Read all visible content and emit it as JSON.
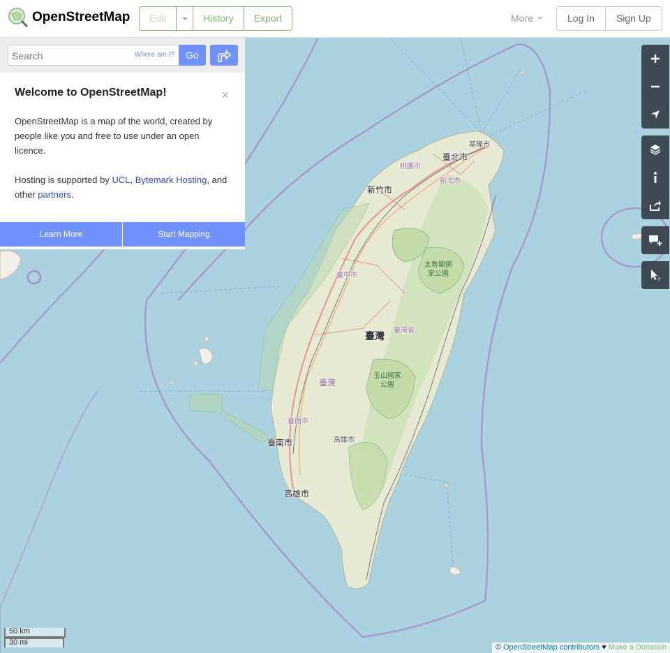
{
  "header": {
    "site_name": "OpenStreetMap",
    "edit_label": "Edit",
    "history_label": "History",
    "export_label": "Export",
    "more_label": "More",
    "login_label": "Log In",
    "signup_label": "Sign Up"
  },
  "search": {
    "placeholder": "Search",
    "where_am_i": "Where am I?",
    "go_label": "Go"
  },
  "welcome": {
    "title": "Welcome to OpenStreetMap!",
    "close": "×",
    "intro": "OpenStreetMap is a map of the world, created by people like you and free to use under an open licence.",
    "hosting_prefix": "Hosting is supported by ",
    "ucl": "UCL",
    "comma": ", ",
    "bytemark": "Bytemark Hosting",
    "and_other": ", and other ",
    "partners": "partners",
    "period": ".",
    "learn_more": "Learn More",
    "start_mapping": "Start Mapping"
  },
  "map": {
    "labels": {
      "keelung": "基隆市",
      "taipei": "臺北市",
      "taoyuan": "桃園市",
      "new_taipei": "新北市",
      "hsinchu": "新竹市",
      "taichung": "臺中市",
      "taiwan": "臺灣",
      "taiwan_province": "臺灣省",
      "taiwan_west": "臺灣",
      "tainan_minor": "臺南市",
      "tainan": "臺南市",
      "kaohsiung_minor": "高雄市",
      "kaohsiung": "高雄市",
      "taroko_1": "太魯閣國",
      "taroko_2": "家公園",
      "yushan_1": "玉山國家",
      "yushan_2": "公園"
    },
    "colors": {
      "water": "#aad3df",
      "land": "#f2efe9",
      "forest": "#d8e8c8",
      "park_border": "#8dbf8a",
      "boundary": "#a68fc7",
      "road": "#e8928e",
      "accent": "#7092ff",
      "brand": "#7ebc6f"
    }
  },
  "controls": {
    "zoom_in": "+",
    "zoom_out": "−"
  },
  "scale": {
    "km": "50 km",
    "mi": "30 mi"
  },
  "attribution": {
    "copyright": "© ",
    "osm_contributors": "OpenStreetMap contributors",
    "heart": " ♥ ",
    "donate": "Make a Donation"
  }
}
